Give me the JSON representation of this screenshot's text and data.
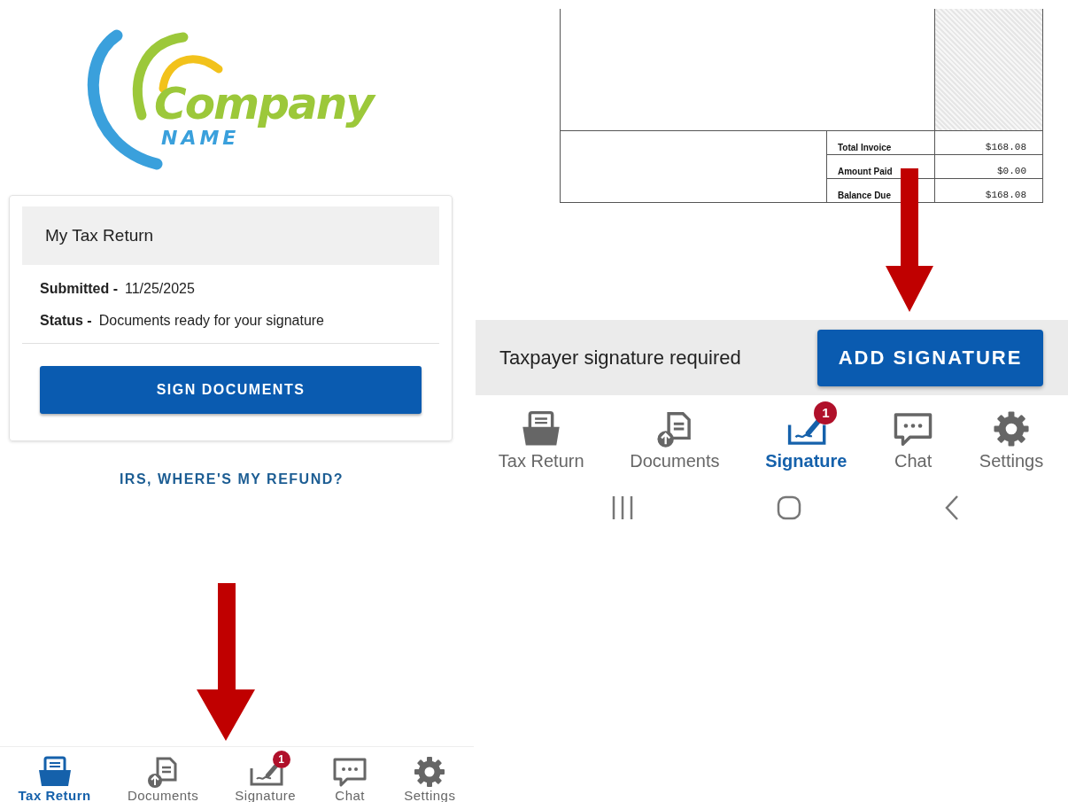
{
  "left_screen": {
    "logo": {
      "name": "Company",
      "subtitle": "NAME"
    },
    "card": {
      "title": "My Tax Return",
      "fields": [
        {
          "label": "Submitted -",
          "value": "11/25/2025"
        },
        {
          "label": "Status -",
          "value": "Documents ready for your signature"
        }
      ],
      "button": "SIGN DOCUMENTS"
    },
    "link": "IRS, WHERE'S MY REFUND?",
    "nav": [
      {
        "label": "Tax Return",
        "selected": true
      },
      {
        "label": "Documents",
        "selected": false
      },
      {
        "label": "Signature",
        "selected": false,
        "badge": "1"
      },
      {
        "label": "Chat",
        "selected": false
      },
      {
        "label": "Settings",
        "selected": false
      }
    ]
  },
  "right_screen": {
    "invoice": {
      "rows": [
        {
          "label": "Total Invoice",
          "amount": "$168.08"
        },
        {
          "label": "Amount Paid",
          "amount": "$0.00"
        },
        {
          "label": "Balance Due",
          "amount": "$168.08"
        }
      ]
    },
    "banner": {
      "text": "Taxpayer signature required",
      "button": "ADD SIGNATURE"
    },
    "nav": [
      {
        "label": "Tax Return",
        "selected": false
      },
      {
        "label": "Documents",
        "selected": false
      },
      {
        "label": "Signature",
        "selected": true,
        "badge": "1"
      },
      {
        "label": "Chat",
        "selected": false
      },
      {
        "label": "Settings",
        "selected": false
      }
    ]
  }
}
